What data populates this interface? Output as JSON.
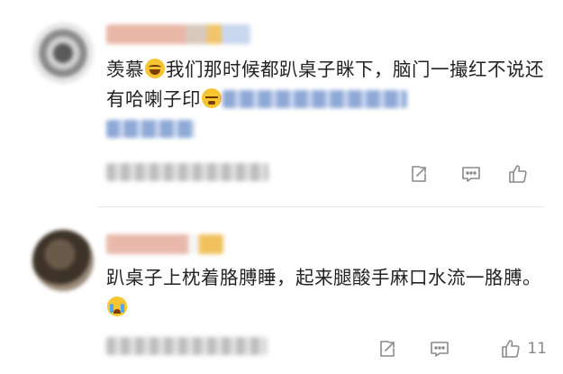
{
  "comments": [
    {
      "text_parts": [
        "羡慕",
        "我们那时候都趴桌子眯下，脑门一撮红不说还有哈喇子印"
      ],
      "emojis": [
        "laugh-emoji",
        "sleep-emoji"
      ],
      "like_count": ""
    },
    {
      "text_parts": [
        "趴桌子上枕着胳膊睡，起来腿酸手麻口水流一胳膊。"
      ],
      "emojis": [
        "cry-emoji"
      ],
      "like_count": "11"
    }
  ],
  "icons": {
    "share": "share-icon",
    "comment": "comment-icon",
    "like": "thumbs-up-icon"
  },
  "colors": {
    "text": "#222222",
    "icon": "#888888",
    "blur_link": "#8fa9d6"
  }
}
